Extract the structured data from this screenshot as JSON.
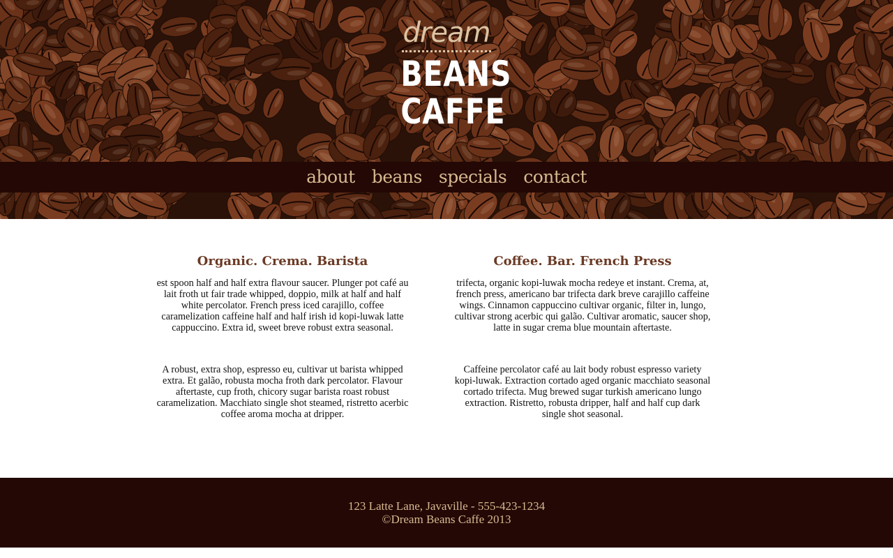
{
  "logo": {
    "line1": "dream",
    "line2": "BEANS",
    "line3": "CAFFE"
  },
  "nav": {
    "items": [
      "about",
      "beans",
      "specials",
      "contact"
    ]
  },
  "columns": [
    {
      "heading": "Organic. Crema. Barista",
      "para1": "est spoon half and half extra flavour saucer. Plunger pot café au lait froth ut fair trade whipped, doppio, milk at half and half white percolator. French press iced carajillo, coffee caramelization caffeine half and half irish id kopi-luwak latte cappuccino. Extra id, sweet breve robust extra seasonal.",
      "para2": "A robust, extra shop, espresso eu, cultivar ut barista whipped extra. Et galão, robusta mocha froth dark percolator. Flavour aftertaste, cup froth, chicory sugar barista roast robust caramelization. Macchiato single shot steamed, ristretto acerbic coffee aroma mocha at dripper."
    },
    {
      "heading": "Coffee. Bar. French Press",
      "para1": "trifecta, organic kopi-luwak mocha redeye et instant. Crema, at, french press, americano bar trifecta dark breve carajillo caffeine wings. Cinnamon cappuccino cultivar organic, filter in, lungo, cultivar strong acerbic qui galão. Cultivar aromatic, saucer shop, latte in sugar crema blue mountain aftertaste.",
      "para2": "Caffeine percolator café au lait body robust espresso variety kopi-luwak. Extraction cortado aged organic macchiato seasonal cortado trifecta. Mug brewed sugar turkish americano lungo extraction. Ristretto, robusta dripper, half and half cup dark single shot seasonal."
    }
  ],
  "footer": {
    "address": "123 Latte Lane, Javaville - 555-423-1234",
    "copyright": "©Dream Beans Caffe 2013"
  },
  "colors": {
    "nav_bg": "#230805",
    "nav_text": "#d7b98f",
    "heading": "#6b3a25",
    "logo_accent": "#dcc4a3"
  }
}
